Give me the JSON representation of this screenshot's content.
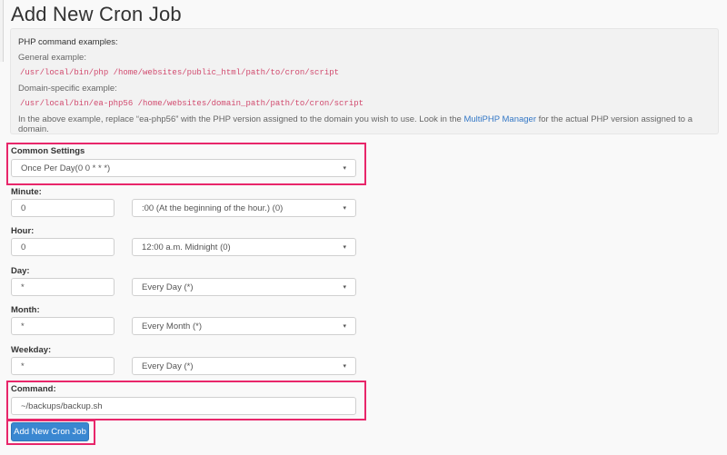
{
  "page": {
    "title": "Add New Cron Job"
  },
  "examples": {
    "heading": "PHP command examples:",
    "general_label": "General example:",
    "general_cmd": "/usr/local/bin/php /home/websites/public_html/path/to/cron/script",
    "domain_label": "Domain-specific example:",
    "domain_cmd": "/usr/local/bin/ea-php56 /home/websites/domain_path/path/to/cron/script",
    "note_before": "In the above example, replace “ea-php56” with the PHP version assigned to the domain you wish to use. Look in the ",
    "note_link": "MultiPHP Manager",
    "note_after": " for the actual PHP version assigned to a domain."
  },
  "form": {
    "common_settings": {
      "label": "Common Settings",
      "selected": "Once Per Day(0 0 * * *)"
    },
    "minute": {
      "label": "Minute:",
      "value": "0",
      "selected": ":00 (At the beginning of the hour.) (0)"
    },
    "hour": {
      "label": "Hour:",
      "value": "0",
      "selected": "12:00 a.m. Midnight (0)"
    },
    "day": {
      "label": "Day:",
      "value": "*",
      "selected": "Every Day (*)"
    },
    "month": {
      "label": "Month:",
      "value": "*",
      "selected": "Every Month (*)"
    },
    "weekday": {
      "label": "Weekday:",
      "value": "*",
      "selected": "Every Day (*)"
    },
    "command": {
      "label": "Command:",
      "value": "~/backups/backup.sh"
    },
    "submit_label": "Add New Cron Job"
  },
  "colors": {
    "highlight": "#e8266a",
    "button": "#3a87d1",
    "code": "#d14a6e",
    "link": "#3478c6"
  },
  "icons": {
    "dropdown": "▾"
  }
}
